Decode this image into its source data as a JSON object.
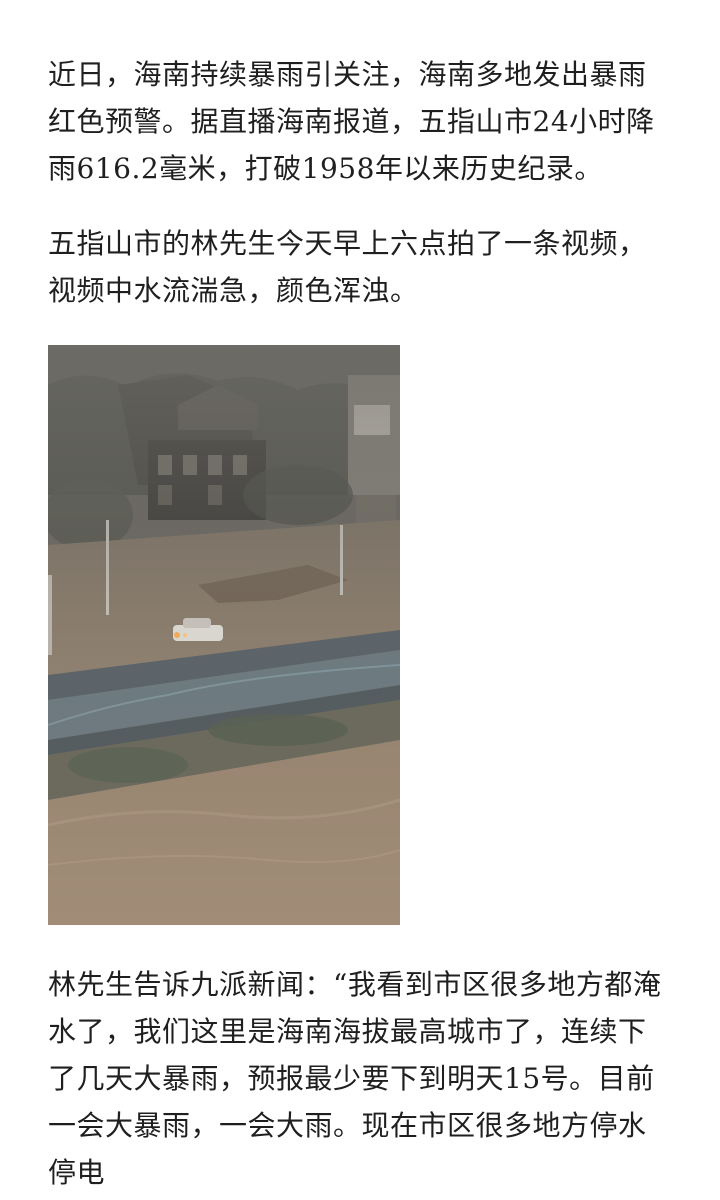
{
  "article": {
    "paragraphs": [
      "近日，海南持续暴雨引关注，海南多地发出暴雨红色预警。据直播海南报道，五指山市24小时降雨616.2毫米，打破1958年以来历史纪录。",
      "五指山市的林先生今天早上六点拍了一条视频，视频中水流湍急，颜色浑浊。",
      "林先生告诉九派新闻：“我看到市区很多地方都淹水了，我们这里是海南海拔最高城市了，连续下了几天大暴雨，预报最少要下到明天15号。目前一会大暴雨，一会大雨。现在市区很多地方停水停电"
    ]
  },
  "colors": {
    "text": "#1f1f1f",
    "background": "#ffffff",
    "flood_water": "#9c8a74",
    "fog": "#6d6b66"
  }
}
